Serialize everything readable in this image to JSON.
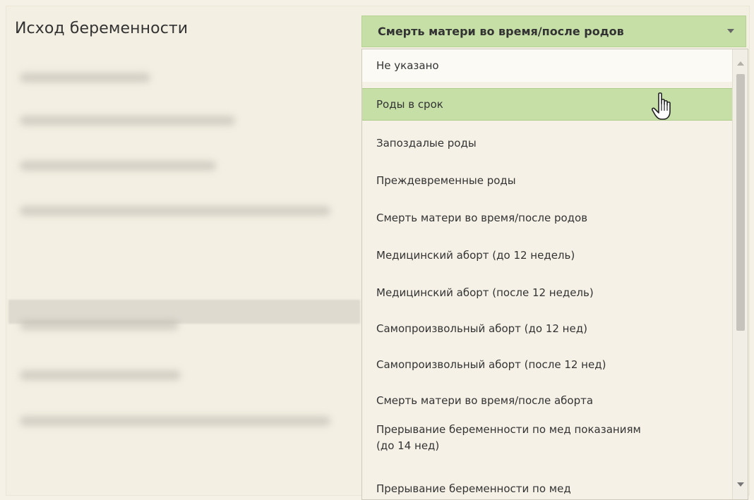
{
  "form": {
    "outcome_label": "Исход беременности"
  },
  "select": {
    "value": "Смерть матери во время/после родов",
    "options": [
      "Не указано",
      "Роды в срок",
      "Запоздалые роды",
      "Преждевременные роды",
      "Смерть матери во время/после родов",
      "Медицинский аборт (до 12 недель)",
      "Медицинский аборт (после 12 недель)",
      "Самопроизвольный аборт (до 12 нед)",
      "Самопроизвольный аборт (после 12 нед)",
      "Смерть матери во время/после аборта",
      "Прерывание беременности по мед показаниям (до 14 нед)",
      "Прерывание беременности по мед"
    ],
    "hovered": "Роды в срок"
  },
  "icons": {
    "cursor": "hand-pointer-icon",
    "select_caret": "chevron-down-icon",
    "scroll_up": "scroll-up-icon",
    "scroll_down": "scroll-down-icon"
  },
  "colors": {
    "selected_green": "#c5dfa6",
    "background": "#f3efe3"
  }
}
